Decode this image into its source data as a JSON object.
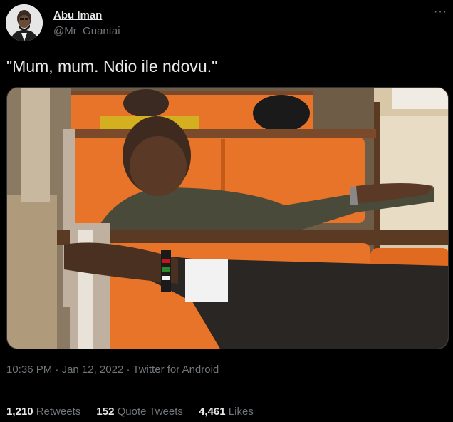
{
  "author": {
    "name": "Abu Iman",
    "handle": "@Mr_Guantai"
  },
  "tweet": {
    "text": "\"Mum, mum. Ndio ile ndovu.\"",
    "time": "10:36 PM",
    "date": "Jan 12, 2022",
    "source": "Twitter for Android",
    "separator": "·"
  },
  "stats": {
    "retweets_count": "1,210",
    "retweets_label": "Retweets",
    "quotes_count": "152",
    "quotes_label": "Quote Tweets",
    "likes_count": "4,461",
    "likes_label": "Likes"
  },
  "icons": {
    "more": "more-options-icon"
  },
  "colors": {
    "background": "#000000",
    "text_primary": "#e7e9ea",
    "text_secondary": "#71767b",
    "divider": "#2f3336",
    "seat_orange": "#e8742a"
  }
}
